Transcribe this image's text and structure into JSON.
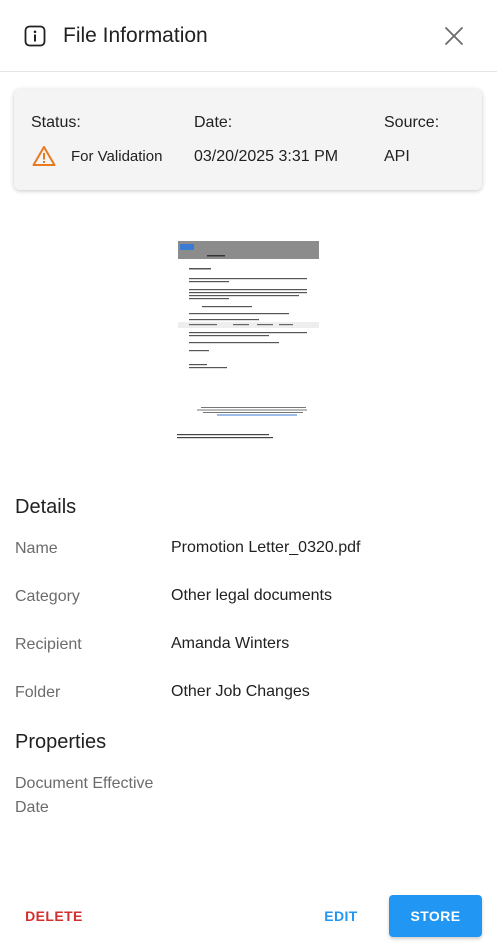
{
  "header": {
    "title": "File Information",
    "info_icon": "info-icon",
    "close_icon": "close-icon"
  },
  "status_card": {
    "status_label": "Status:",
    "status_value": "For Validation",
    "status_icon": "warning-icon",
    "status_color": "#e8791e",
    "date_label": "Date:",
    "date_value": "03/20/2025 3:31 PM",
    "source_label": "Source:",
    "source_value": "API"
  },
  "details": {
    "title": "Details",
    "fields": [
      {
        "label": "Name",
        "value": "Promotion Letter_0320.pdf"
      },
      {
        "label": "Category",
        "value": "Other legal documents"
      },
      {
        "label": "Recipient",
        "value": "Amanda Winters"
      },
      {
        "label": "Folder",
        "value": "Other Job Changes"
      }
    ]
  },
  "properties": {
    "title": "Properties",
    "fields": [
      {
        "label": "Document Effective Date",
        "value": ""
      }
    ]
  },
  "footer": {
    "delete_label": "DELETE",
    "edit_label": "EDIT",
    "store_label": "STORE"
  },
  "colors": {
    "primary": "#2196f3",
    "danger": "#d32f2f",
    "warning": "#e8791e"
  }
}
